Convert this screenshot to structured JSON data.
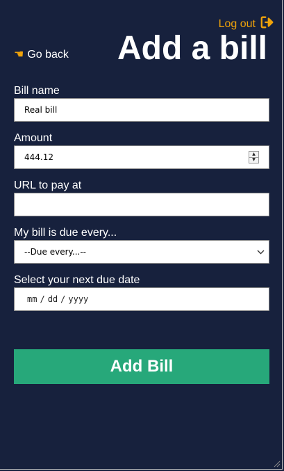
{
  "header": {
    "logout_label": "Log out",
    "back_label": "Go back",
    "title": "Add a bill"
  },
  "form": {
    "bill_name": {
      "label": "Bill name",
      "value": "Real bill"
    },
    "amount": {
      "label": "Amount",
      "value": "444.12"
    },
    "url": {
      "label": "URL to pay at",
      "value": ""
    },
    "frequency": {
      "label": "My bill is due every...",
      "selected": "--Due every...--"
    },
    "due_date": {
      "label": "Select your next due date",
      "mm": "mm",
      "dd": "dd",
      "yyyy": "yyyy"
    },
    "submit_label": "Add Bill"
  },
  "colors": {
    "background": "#17213d",
    "accent": "#f0a30a",
    "submit": "#27a87a"
  }
}
